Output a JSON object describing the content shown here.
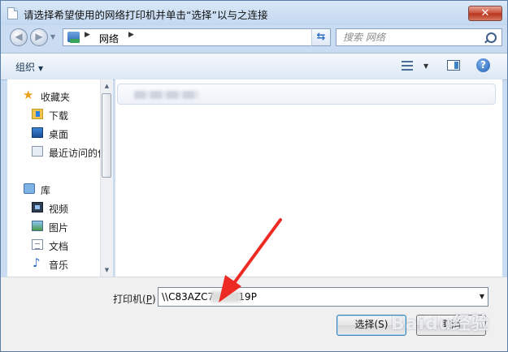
{
  "window": {
    "title": "请选择希望使用的网络打印机并单击“选择”以与之连接",
    "close_label": "✕"
  },
  "address_bar": {
    "location": "网络",
    "search_placeholder": "搜索 网络"
  },
  "toolbar": {
    "organize_label": "组织"
  },
  "nav_pane": {
    "favorites": {
      "label": "收藏夹",
      "items": [
        {
          "label": "下载",
          "icon": "download-folder-icon"
        },
        {
          "label": "桌面",
          "icon": "desktop-icon"
        },
        {
          "label": "最近访问的位",
          "icon": "recent-places-icon"
        }
      ]
    },
    "libraries": {
      "label": "库",
      "items": [
        {
          "label": "视频",
          "icon": "video-library-icon"
        },
        {
          "label": "图片",
          "icon": "picture-library-icon"
        },
        {
          "label": "文档",
          "icon": "document-library-icon"
        },
        {
          "label": "音乐",
          "icon": "music-library-icon"
        }
      ]
    }
  },
  "bottom": {
    "printer_label": "打印机(",
    "printer_accel": "P",
    "printer_label_end": ")",
    "printer_value": "\\\\C83AZC7       I19P",
    "select_button": "选择(S)",
    "cancel_button": "取消"
  },
  "watermark": "Baidu经验",
  "colors": {
    "chrome": "#c9dcf2",
    "close_button": "#c9503a",
    "annotation_arrow": "#ee2a24"
  }
}
